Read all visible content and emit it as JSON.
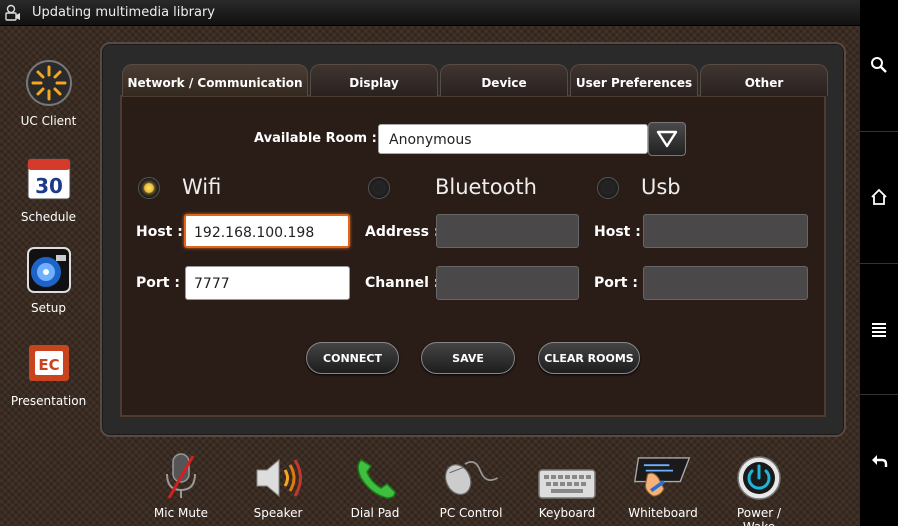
{
  "status_bar": {
    "title": "Updating multimedia library",
    "icon": "media-sync-icon"
  },
  "right_nav": [
    {
      "icon": "search-icon"
    },
    {
      "icon": "home-icon"
    },
    {
      "icon": "menu-icon"
    },
    {
      "icon": "back-icon"
    }
  ],
  "sidebar": {
    "items": [
      {
        "label": "UC Client",
        "icon": "uc-client-icon"
      },
      {
        "label": "Schedule",
        "icon": "calendar-icon",
        "date": "30"
      },
      {
        "label": "Setup",
        "icon": "setup-icon"
      },
      {
        "label": "Presentation",
        "icon": "presentation-icon"
      }
    ]
  },
  "tabs": [
    {
      "label": "Network / Communication",
      "active": true
    },
    {
      "label": "Display",
      "active": false
    },
    {
      "label": "Device",
      "active": false
    },
    {
      "label": "User Preferences",
      "active": false
    },
    {
      "label": "Other",
      "active": false
    }
  ],
  "room": {
    "label": "Available Room :",
    "value": "Anonymous"
  },
  "connections": {
    "wifi": {
      "label": "Wifi",
      "selected": true,
      "host_label": "Host :",
      "host_value": "192.168.100.198",
      "port_label": "Port :",
      "port_value": "7777"
    },
    "bluetooth": {
      "label": "Bluetooth",
      "selected": false,
      "address_label": "Address :",
      "address_value": "",
      "channel_label": "Channel :",
      "channel_value": ""
    },
    "usb": {
      "label": "Usb",
      "selected": false,
      "host_label": "Host :",
      "host_value": "",
      "port_label": "Port :",
      "port_value": ""
    }
  },
  "buttons": {
    "connect": "CONNECT",
    "save": "SAVE",
    "clear_rooms": "CLEAR ROOMS"
  },
  "dock": [
    {
      "label": "Mic Mute",
      "icon": "mic-mute-icon"
    },
    {
      "label": "Speaker",
      "icon": "speaker-icon"
    },
    {
      "label": "Dial Pad",
      "icon": "phone-icon"
    },
    {
      "label": "PC Control",
      "icon": "mouse-icon"
    },
    {
      "label": "Keyboard",
      "icon": "keyboard-icon"
    },
    {
      "label": "Whiteboard",
      "icon": "whiteboard-icon"
    },
    {
      "label": "Power / Wake",
      "icon": "power-icon"
    }
  ],
  "colors": {
    "accent_focus": "#e0661c",
    "radio_on": "#ffcf40",
    "power_blue": "#1fb4d8"
  }
}
